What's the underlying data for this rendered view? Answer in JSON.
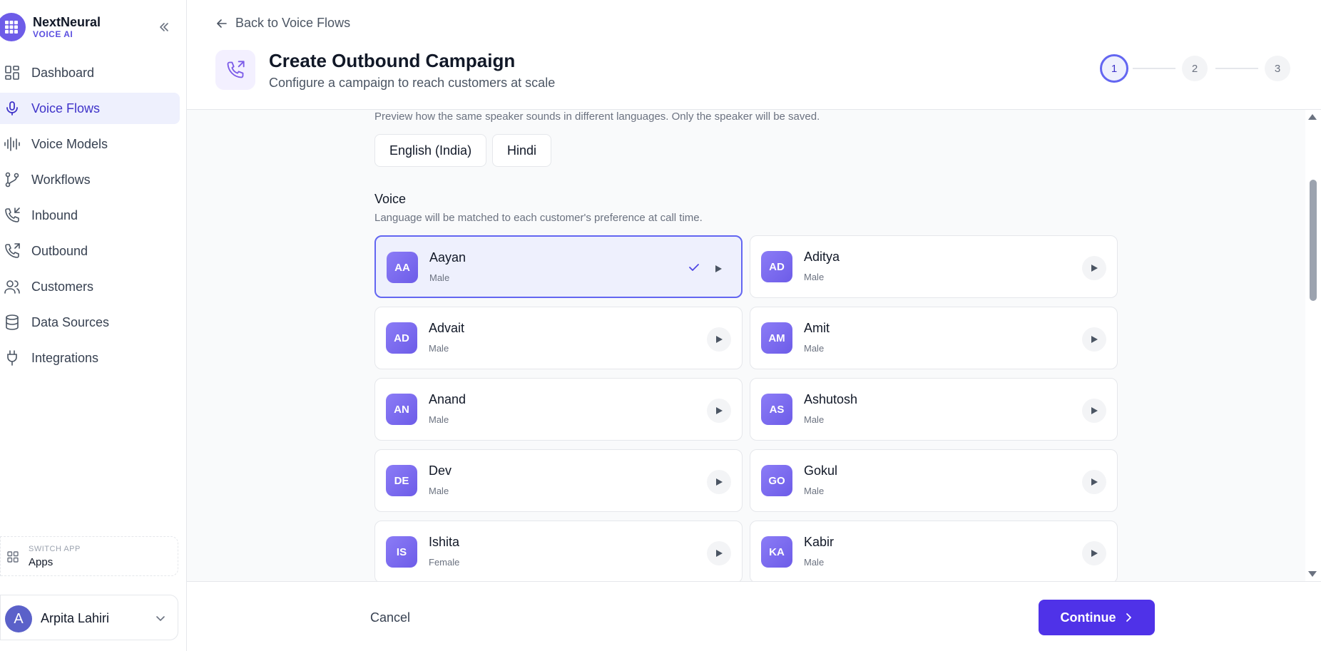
{
  "brand": {
    "name": "NextNeural",
    "subtitle": "VOICE AI"
  },
  "sidebar": {
    "items": [
      {
        "label": "Dashboard",
        "icon": "dashboard-icon",
        "active": false
      },
      {
        "label": "Voice Flows",
        "icon": "microphone-icon",
        "active": true
      },
      {
        "label": "Voice Models",
        "icon": "waveform-icon",
        "active": false
      },
      {
        "label": "Workflows",
        "icon": "branch-icon",
        "active": false
      },
      {
        "label": "Inbound",
        "icon": "phone-incoming-icon",
        "active": false
      },
      {
        "label": "Outbound",
        "icon": "phone-outgoing-icon",
        "active": false
      },
      {
        "label": "Customers",
        "icon": "users-icon",
        "active": false
      },
      {
        "label": "Data Sources",
        "icon": "database-icon",
        "active": false
      },
      {
        "label": "Integrations",
        "icon": "plug-icon",
        "active": false
      }
    ],
    "switch_app": {
      "label": "SWITCH APP",
      "value": "Apps"
    },
    "user": {
      "initial": "A",
      "name": "Arpita Lahiri"
    }
  },
  "header": {
    "back_label": "Back to Voice Flows",
    "title": "Create Outbound Campaign",
    "subtitle": "Configure a campaign to reach customers at scale",
    "steps": [
      "1",
      "2",
      "3"
    ],
    "active_step": 1
  },
  "content": {
    "preview_hint": "Preview how the same speaker sounds in different languages. Only the speaker will be saved.",
    "languages": [
      "English (India)",
      "Hindi"
    ],
    "voice_label": "Voice",
    "voice_hint": "Language will be matched to each customer's preference at call time.",
    "voices": [
      {
        "initials": "AA",
        "name": "Aayan",
        "gender": "Male",
        "selected": true
      },
      {
        "initials": "AD",
        "name": "Aditya",
        "gender": "Male",
        "selected": false
      },
      {
        "initials": "AD",
        "name": "Advait",
        "gender": "Male",
        "selected": false
      },
      {
        "initials": "AM",
        "name": "Amit",
        "gender": "Male",
        "selected": false
      },
      {
        "initials": "AN",
        "name": "Anand",
        "gender": "Male",
        "selected": false
      },
      {
        "initials": "AS",
        "name": "Ashutosh",
        "gender": "Male",
        "selected": false
      },
      {
        "initials": "DE",
        "name": "Dev",
        "gender": "Male",
        "selected": false
      },
      {
        "initials": "GO",
        "name": "Gokul",
        "gender": "Male",
        "selected": false
      },
      {
        "initials": "IS",
        "name": "Ishita",
        "gender": "Female",
        "selected": false
      },
      {
        "initials": "KA",
        "name": "Kabir",
        "gender": "Male",
        "selected": false
      }
    ]
  },
  "footer": {
    "cancel_label": "Cancel",
    "continue_label": "Continue"
  },
  "colors": {
    "accent": "#4f32e8",
    "selected_bg": "#eef0fd",
    "selected_border": "#6366f1",
    "avatar": "#7c6cf2"
  }
}
